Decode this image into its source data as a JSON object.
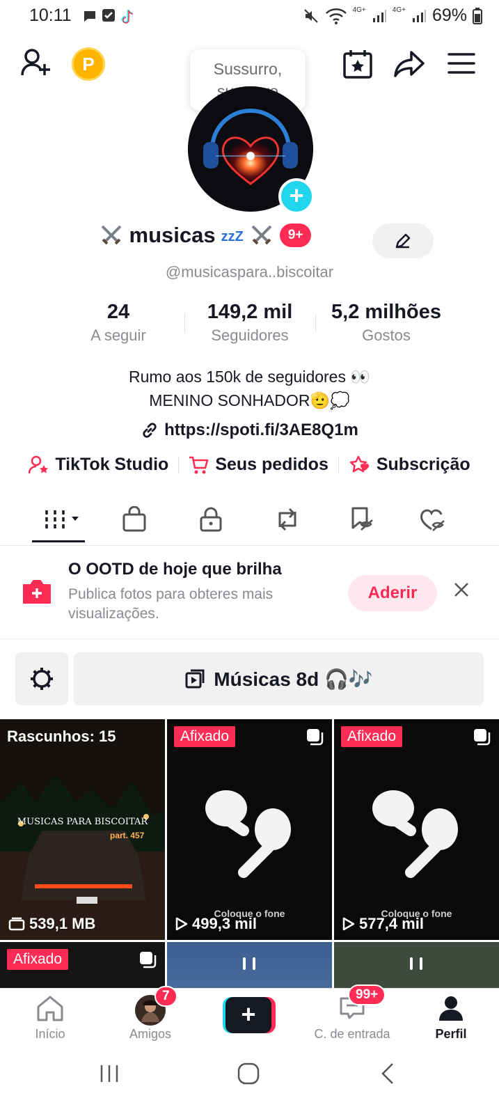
{
  "status_bar": {
    "time": "10:11",
    "battery": "69%",
    "signal1": "4G+",
    "signal2": "4G+"
  },
  "header": {
    "icons": [
      "add-friend-icon",
      "coin-icon",
      "calendar-star-icon",
      "share-icon",
      "menu-icon"
    ],
    "coin_letter": "P",
    "bubble_line1": "Sussurro,",
    "bubble_line2": "sussurro"
  },
  "profile": {
    "name": "musicas",
    "name_sleep_glyph": "zzZ",
    "notif_count": "9+",
    "handle": "@musicaspara..biscoitar",
    "stats": [
      {
        "value": "24",
        "label": "A seguir"
      },
      {
        "value": "149,2 mil",
        "label": "Seguidores"
      },
      {
        "value": "5,2 milhões",
        "label": "Gostos"
      }
    ],
    "bio_line1": "Rumo aos 150k de seguidores 👀",
    "bio_line2": "MENINO SONHADOR🫡💭",
    "link": "https://spoti.fi/3AE8Q1m"
  },
  "tools": [
    {
      "label": "TikTok Studio",
      "icon": "person-star-icon"
    },
    {
      "label": "Seus pedidos",
      "icon": "cart-icon"
    },
    {
      "label": "Subscrição",
      "icon": "star-heart-icon"
    }
  ],
  "tabs": [
    "videos-grid-tab",
    "shop-tab",
    "private-tab",
    "reposts-tab",
    "favorites-tab",
    "liked-tab"
  ],
  "ootd": {
    "title": "O OOTD de hoje que brilha",
    "desc": "Publica fotos para obteres mais visualizações.",
    "join": "Aderir"
  },
  "playlist": {
    "label": "Músicas 8d 🎧🎶"
  },
  "videos": [
    {
      "top_label": "Rascunhos: 15",
      "bottom": "539,1 MB",
      "overlay_title": "MUSICAS PARA BISCOITAR",
      "overlay_part": "part. 457"
    },
    {
      "top_label": "Afixado",
      "bottom": "499,3 mil",
      "caption": "Coloque o fone"
    },
    {
      "top_label": "Afixado",
      "bottom": "577,4 mil",
      "caption": "Coloque o fone"
    },
    {
      "top_label": "Afixado"
    },
    {},
    {}
  ],
  "bottom_nav": [
    {
      "label": "Início"
    },
    {
      "label": "Amigos",
      "badge": "7"
    },
    {
      "label": ""
    },
    {
      "label": "C. de entrada",
      "badge": "99+"
    },
    {
      "label": "Perfil"
    }
  ],
  "colors": {
    "accent": "#fe2c55",
    "cyan": "#20d5ec",
    "text": "#161823",
    "muted": "#8a8b91"
  }
}
